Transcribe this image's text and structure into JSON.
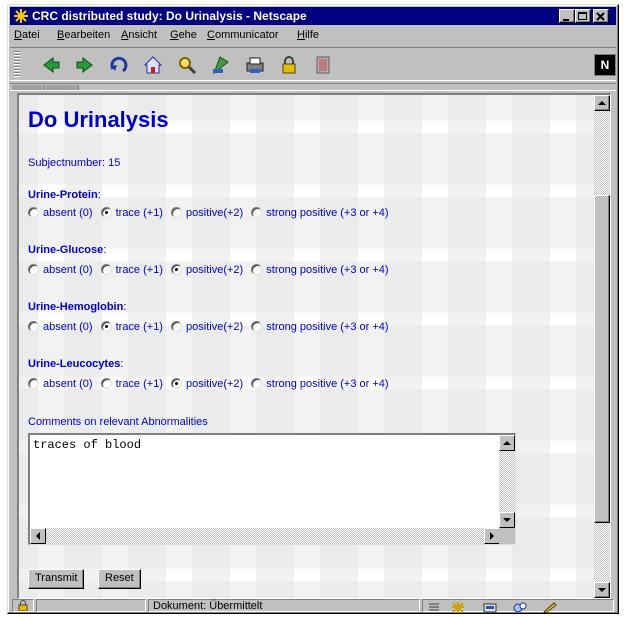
{
  "window": {
    "title": "CRC distributed study: Do Urinalysis - Netscape"
  },
  "menubar": {
    "items": [
      {
        "label": "Datei",
        "accel": "D",
        "rest": "atei"
      },
      {
        "label": "Bearbeiten",
        "accel": "B",
        "rest": "earbeiten"
      },
      {
        "label": "Ansicht",
        "accel": "A",
        "rest": "nsicht"
      },
      {
        "label": "Gehe",
        "accel": "G",
        "rest": "ehe"
      },
      {
        "label": "Communicator",
        "accel": "C",
        "rest": "ommunicator"
      },
      {
        "label": "Hilfe",
        "accel": "H",
        "rest": "ilfe"
      }
    ]
  },
  "toolbar": {
    "icons": [
      "back-icon",
      "forward-icon",
      "reload-icon",
      "home-icon",
      "search-icon",
      "guide-icon",
      "print-icon",
      "security-icon",
      "stop-icon"
    ],
    "logo": "N"
  },
  "page": {
    "title": "Do Urinalysis",
    "subject_label": "Subjectnumber:",
    "subject_number": "15",
    "fields": [
      {
        "label": "Urine-Protein",
        "selected": 1
      },
      {
        "label": "Urine-Glucose",
        "selected": 2
      },
      {
        "label": "Urine-Hemoglobin",
        "selected": 1
      },
      {
        "label": "Urine-Leucocytes",
        "selected": 2
      }
    ],
    "options": [
      "absent (0)",
      "trace (+1)",
      "positive(+2)",
      "strong positive (+3 or +4)"
    ],
    "comments_label": "Comments on relevant Abnormalities",
    "comments_value": "traces of blood",
    "transmit_label": "Transmit",
    "reset_label": "Reset"
  },
  "status": {
    "text": "Dokument: Übermittelt"
  },
  "colors": {
    "title_bar": "#000080",
    "link_blue": "#0000cc",
    "chrome": "#c0c0c0"
  }
}
